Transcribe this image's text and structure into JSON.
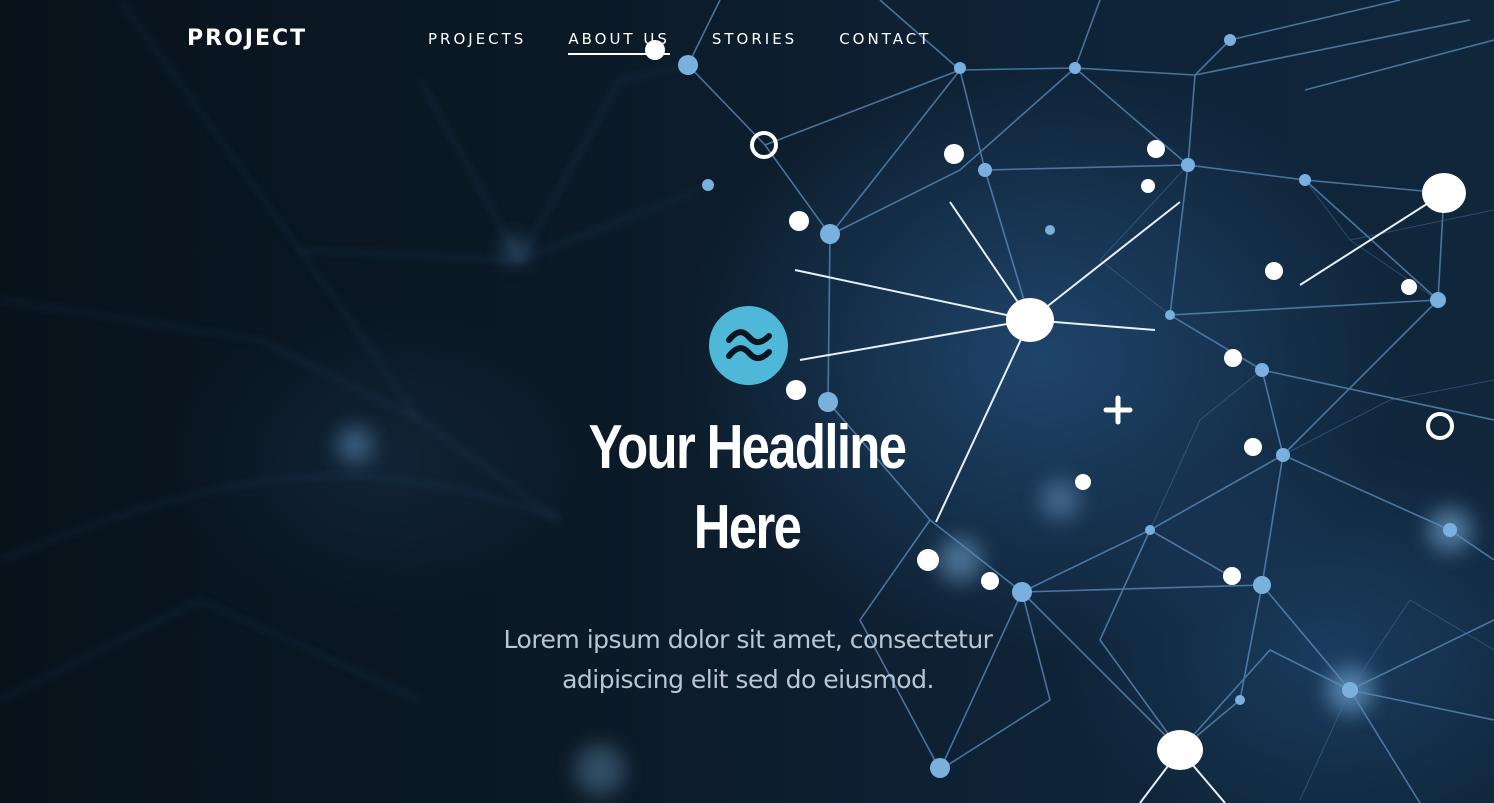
{
  "nav": {
    "brand": "PROJECT",
    "links": [
      {
        "label": "PROJECTS",
        "active": false
      },
      {
        "label": "ABOUT US",
        "active": true
      },
      {
        "label": "STORIES",
        "active": false
      },
      {
        "label": "CONTACT",
        "active": false
      }
    ]
  },
  "hero": {
    "logo_icon": "wave-circle-icon",
    "headline_line1": "Your Headline",
    "headline_line2": "Here",
    "subtext_line1": "Lorem ipsum dolor sit amet, consectetur",
    "subtext_line2": "adipiscing elit sed do eiusmod."
  },
  "colors": {
    "accent": "#4fb8d8",
    "background": "#0a1520",
    "text_primary": "#ffffff",
    "text_secondary": "#b9c6d4"
  }
}
